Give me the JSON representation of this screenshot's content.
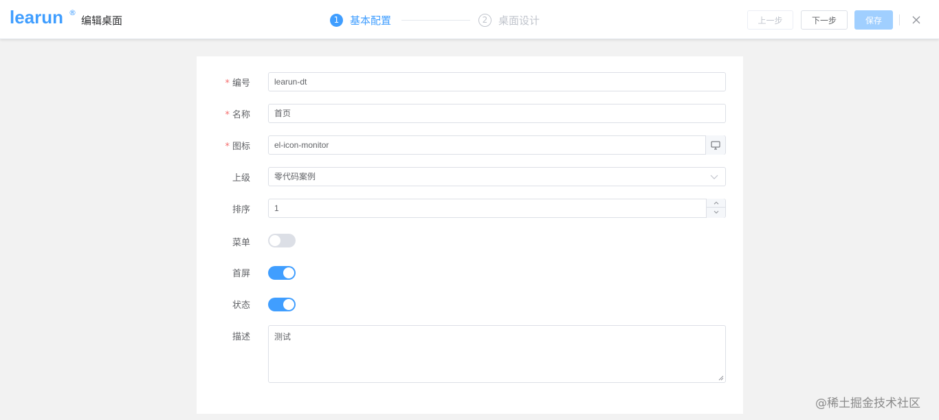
{
  "header": {
    "logo_text": "learun",
    "logo_reg": "®",
    "title": "编辑桌面",
    "steps": [
      {
        "num": "1",
        "label": "基本配置",
        "state": "active"
      },
      {
        "num": "2",
        "label": "桌面设计",
        "state": "inactive"
      }
    ],
    "buttons": {
      "prev": "上一步",
      "next": "下一步",
      "save": "保存"
    },
    "close_icon": "close-icon"
  },
  "form": {
    "code": {
      "label": "编号",
      "required": "*",
      "value": "learun-dt"
    },
    "name": {
      "label": "名称",
      "required": "*",
      "value": "首页"
    },
    "icon": {
      "label": "图标",
      "required": "*",
      "value": "el-icon-monitor",
      "append_icon": "monitor-icon"
    },
    "parent": {
      "label": "上级",
      "value": "零代码案例",
      "arrow_icon": "chevron-down-icon"
    },
    "sort": {
      "label": "排序",
      "value": "1"
    },
    "menu": {
      "label": "菜单",
      "on": false
    },
    "home": {
      "label": "首屏",
      "on": true
    },
    "status": {
      "label": "状态",
      "on": true
    },
    "desc": {
      "label": "描述",
      "value": "测试"
    }
  },
  "colors": {
    "primary": "#409eff",
    "required": "#f56c6c",
    "disabled": "#a0cfff",
    "background": "#f2f2f2"
  },
  "watermark": "@稀土掘金技术社区"
}
